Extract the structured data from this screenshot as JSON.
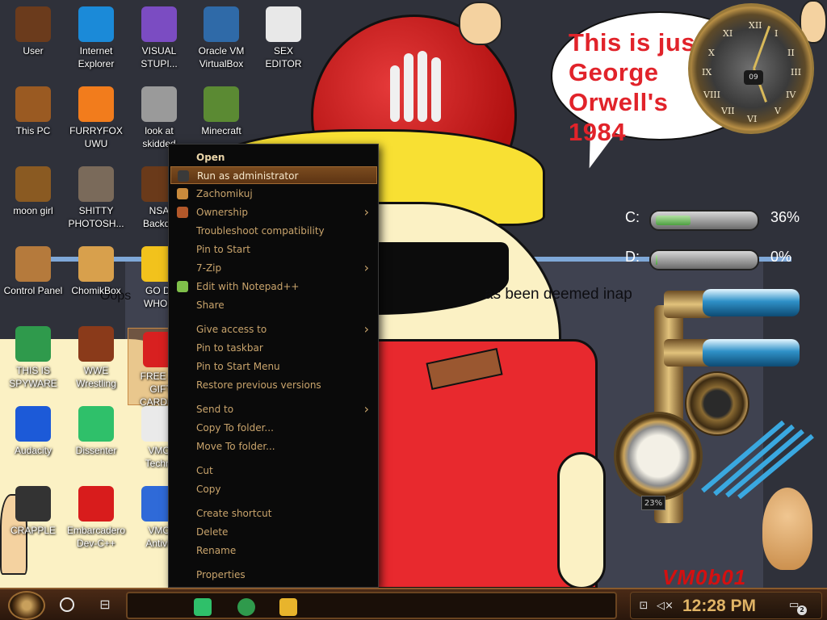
{
  "wallpaper": {
    "speech_bubble": [
      "This is just like",
      "George Orwell's",
      "1984"
    ],
    "partial_text_left": "Oops",
    "partial_text_right": "as been deemed inap",
    "signature": "VM0b01"
  },
  "clock": {
    "date": "09",
    "numerals": [
      "XII",
      "I",
      "II",
      "III",
      "IV",
      "V",
      "VI",
      "VII",
      "VIII",
      "IX",
      "X",
      "XI"
    ]
  },
  "drives": [
    {
      "label": "C:",
      "percent": "36%",
      "used_fraction": 0.36
    },
    {
      "label": "D:",
      "percent": "0%",
      "used_fraction": 0.0
    }
  ],
  "gauge": {
    "readout": "23%"
  },
  "desktop_icons": [
    {
      "label": "User",
      "icon": "user-folder-icon",
      "color": "#6b3b1c"
    },
    {
      "label": "Internet\nExplorer",
      "icon": "edge-browser-icon",
      "color": "#1b8ad8"
    },
    {
      "label": "VISUAL\nSTUPI...",
      "icon": "visual-studio-icon",
      "color": "#7b4cc2"
    },
    {
      "label": "Oracle VM\nVirtualBox",
      "icon": "virtualbox-icon",
      "color": "#2f6aa8"
    },
    {
      "label": "SEX\nEDITOR",
      "icon": "hex-editor-icon",
      "color": "#e8e8e8"
    },
    {
      "label": "This PC",
      "icon": "this-pc-icon",
      "color": "#9a5a22"
    },
    {
      "label": "FURRYFOX\nUWU",
      "icon": "firefox-icon",
      "color": "#f27c1c"
    },
    {
      "label": "look at\nskidded",
      "icon": "shortcut-stack-icon",
      "color": "#9a9a9a"
    },
    {
      "label": "Minecraft",
      "icon": "minecraft-icon",
      "color": "#5b8a33"
    },
    {
      "label": "moon girl",
      "icon": "moon-girl-icon",
      "color": "#8a5a22"
    },
    {
      "label": "SHITTY\nPHOTOSH...",
      "icon": "gimp-icon",
      "color": "#7a6a5a"
    },
    {
      "label": "NSA\nBackdo",
      "icon": "nsa-backdoor-icon",
      "color": "#6a3a1a"
    },
    {
      "label": "Control Panel",
      "icon": "control-panel-icon",
      "color": "#b57a3c"
    },
    {
      "label": "ChomikBox",
      "icon": "chomikbox-icon",
      "color": "#d8a04c"
    },
    {
      "label": "GO DI\nWHOR",
      "icon": "dialog-icon",
      "color": "#f2c21c"
    },
    {
      "label": "THIS IS\nSPYWARE",
      "icon": "chrome-icon",
      "color": "#2f9a4c"
    },
    {
      "label": "WWE\nWrestling",
      "icon": "wwe-wrestling-icon",
      "color": "#8a3a1a"
    },
    {
      "label": "FREE AP\nGIFT\nCARDS...",
      "icon": "apple-icon",
      "color": "#d82020"
    },
    {
      "label": "Audacity",
      "icon": "audacity-icon",
      "color": "#1c5ad8"
    },
    {
      "label": "Dissenter",
      "icon": "dissenter-icon",
      "color": "#2fc06a"
    },
    {
      "label": "VMO\nTechni",
      "icon": "tech-support-icon",
      "color": "#eaeaea"
    },
    {
      "label": "CRAPPLE",
      "icon": "unity-icon",
      "color": "#333333"
    },
    {
      "label": "Embarcadero\nDev-C++",
      "icon": "devcpp-icon",
      "color": "#d81c1c"
    },
    {
      "label": "VMO\nAntivir",
      "icon": "antivirus-shield-icon",
      "color": "#2f6ad8"
    }
  ],
  "context_menu": {
    "items": [
      {
        "label": "Open",
        "bold": true,
        "submenu": false
      },
      {
        "label": "Run as administrator",
        "highlight": true,
        "submenu": false
      },
      {
        "label": "Zachomikuj",
        "submenu": false
      },
      {
        "label": "Ownership",
        "submenu": true
      },
      {
        "label": "Troubleshoot compatibility",
        "submenu": false
      },
      {
        "label": "Pin to Start",
        "submenu": false
      },
      {
        "label": "7-Zip",
        "submenu": true
      },
      {
        "label": "Edit with Notepad++",
        "submenu": false
      },
      {
        "label": "Share",
        "submenu": false
      },
      {
        "label": "Give access to",
        "submenu": true
      },
      {
        "label": "Pin to taskbar",
        "submenu": false
      },
      {
        "label": "Pin to Start Menu",
        "submenu": false
      },
      {
        "label": "Restore previous versions",
        "submenu": false
      },
      {
        "label": "Send to",
        "submenu": true
      },
      {
        "label": "Copy To folder...",
        "submenu": false
      },
      {
        "label": "Move To folder...",
        "submenu": false
      },
      {
        "label": "Cut",
        "submenu": false
      },
      {
        "label": "Copy",
        "submenu": false
      },
      {
        "label": "Create shortcut",
        "submenu": false
      },
      {
        "label": "Delete",
        "submenu": false
      },
      {
        "label": "Rename",
        "submenu": false
      },
      {
        "label": "Properties",
        "submenu": false
      }
    ]
  },
  "taskbar": {
    "pinned": [
      {
        "name": "dissenter-taskbar-icon",
        "color": "#2fc06a"
      },
      {
        "name": "chrome-taskbar-icon",
        "color": "#2f9a4c"
      },
      {
        "name": "file-explorer-taskbar-icon",
        "color": "#e8b42c"
      }
    ],
    "time": "12:28 PM",
    "notification_count": "2"
  }
}
